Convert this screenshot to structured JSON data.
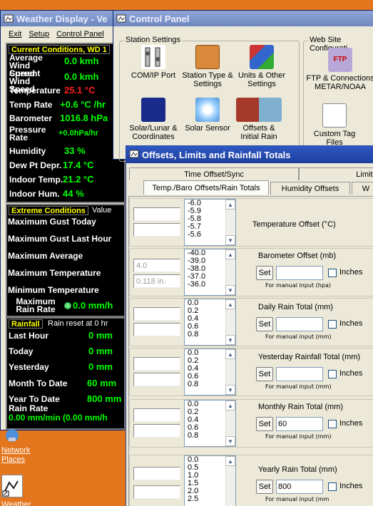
{
  "weather_window": {
    "title": "Weather Display - Ve",
    "menu": [
      "Exit",
      "Setup",
      "Control Panel"
    ],
    "current": {
      "header": "Current Conditions, WD 1",
      "rows": [
        {
          "label": "Average Wind Speed",
          "value": "0.0 kmh"
        },
        {
          "label": "Current Wind Speed",
          "value": "0.0 kmh"
        },
        {
          "label": "Temperature",
          "value": "25.1 °C"
        },
        {
          "label": "Temp Rate",
          "value": "+0.6 °C /hr"
        },
        {
          "label": "Barometer",
          "value": "1016.8 hPa"
        },
        {
          "label": "Pressure Rate",
          "value": "+0.0hPa/hr"
        },
        {
          "label": "Humidity",
          "value": "33 %"
        },
        {
          "label": "Dew Pt Depr.",
          "value": "17.4 °C"
        },
        {
          "label": "Indoor Temp.",
          "value": "21.2 °C"
        },
        {
          "label": "Indoor Hum.",
          "value": "44 %"
        }
      ]
    },
    "extreme": {
      "header": "Extreme Conditions",
      "header2": "Value",
      "rows": [
        "Maximum Gust Today",
        "Maximum Gust Last Hour",
        "Maximum Average",
        "Maximum Temperature",
        "Minimum Temperature"
      ],
      "max_rain_label": "Maximum Rain Rate",
      "max_rain_value": "0.0 mm/h"
    },
    "rainfall": {
      "header": "Rainfall",
      "header2": "Rain reset at 0 hr",
      "rows": [
        {
          "label": "Last Hour",
          "value": "0 mm"
        },
        {
          "label": "Today",
          "value": "0 mm"
        },
        {
          "label": "Yesterday",
          "value": "0 mm"
        },
        {
          "label": "Month To Date",
          "value": "60 mm"
        },
        {
          "label": "Year To Date",
          "value": "800 mm"
        }
      ],
      "rate_label": "Rain Rate",
      "rate_value": "0.00 mm/min (0.00 mm/h"
    }
  },
  "desktop": {
    "network_places": "Network Places",
    "weather_icon": "Weather"
  },
  "control_panel": {
    "title": "Control Panel",
    "station_group": "Station Settings",
    "web_group": "Web Site Configurati",
    "items": [
      "COM/IP Port",
      "Station Type & Settings",
      "Units & Other Settings",
      "Solar/Lunar & Coordinates",
      "Solar Sensor",
      "Offsets & Initial Rain",
      "FTP & Connections METAR/NOAA",
      "Custom Tag Files"
    ],
    "ftp_icon_text": "FTP"
  },
  "offsets": {
    "title": "Offsets, Limits and Rainfall Totals",
    "tabs_row1": [
      "Time Offset/Sync",
      "Limits"
    ],
    "tabs_row2": [
      "Temp./Baro Offsets/Rain Totals",
      "Humidity Offsets",
      "W"
    ],
    "rows": [
      {
        "label": "Temperature Offset  (°C)",
        "items": [
          "-6.0",
          "-5.9",
          "-5.8",
          "-5.7",
          "-5.6"
        ],
        "in1": "",
        "in2": ""
      },
      {
        "label": "Barometer Offset (mb)",
        "items": [
          "-40.0",
          "-39.0",
          "-38.0",
          "-37.0",
          "-36.0"
        ],
        "in1": "4.0",
        "in2": "0.118 in.",
        "set_value": "",
        "inches": "Inches",
        "hint": "For manual input (hpa)"
      },
      {
        "label": "Daily Rain Total  (mm)",
        "items": [
          "0.0",
          "0.2",
          "0.4",
          "0.6",
          "0.8"
        ],
        "in1": "",
        "in2": "",
        "set_value": "",
        "inches": "Inches",
        "hint": "For manual input (mm)"
      },
      {
        "label": "Yesterday Rainfall Total (mm)",
        "items": [
          "0.0",
          "0.2",
          "0.4",
          "0.6",
          "0.8"
        ],
        "in1": "",
        "in2": "",
        "set_value": "",
        "inches": "Inches",
        "hint": "For manual input (mm)"
      },
      {
        "label": "Monthly Rain Total (mm)",
        "items": [
          "0.0",
          "0.2",
          "0.4",
          "0.6",
          "0.8"
        ],
        "in1": "",
        "in2": "",
        "set_value": "60",
        "inches": "Inches",
        "hint": "For manual input (mm)"
      },
      {
        "label": "Yearly Rain Total (mm)",
        "items": [
          "0.0",
          "0.5",
          "1.0",
          "1.5",
          "2.0",
          "2.5"
        ],
        "in1": "",
        "in2": "",
        "set_value": "800",
        "inches": "Inches",
        "hint": "For manual input (mm"
      }
    ],
    "set_label": "Set"
  },
  "colors": {
    "lime": "#00ff00",
    "red": "#ff2020",
    "current_header": "#ffff00",
    "extreme_header": "#ffff00",
    "rain_header_bg": "#000",
    "desktop": "#e4761e"
  }
}
